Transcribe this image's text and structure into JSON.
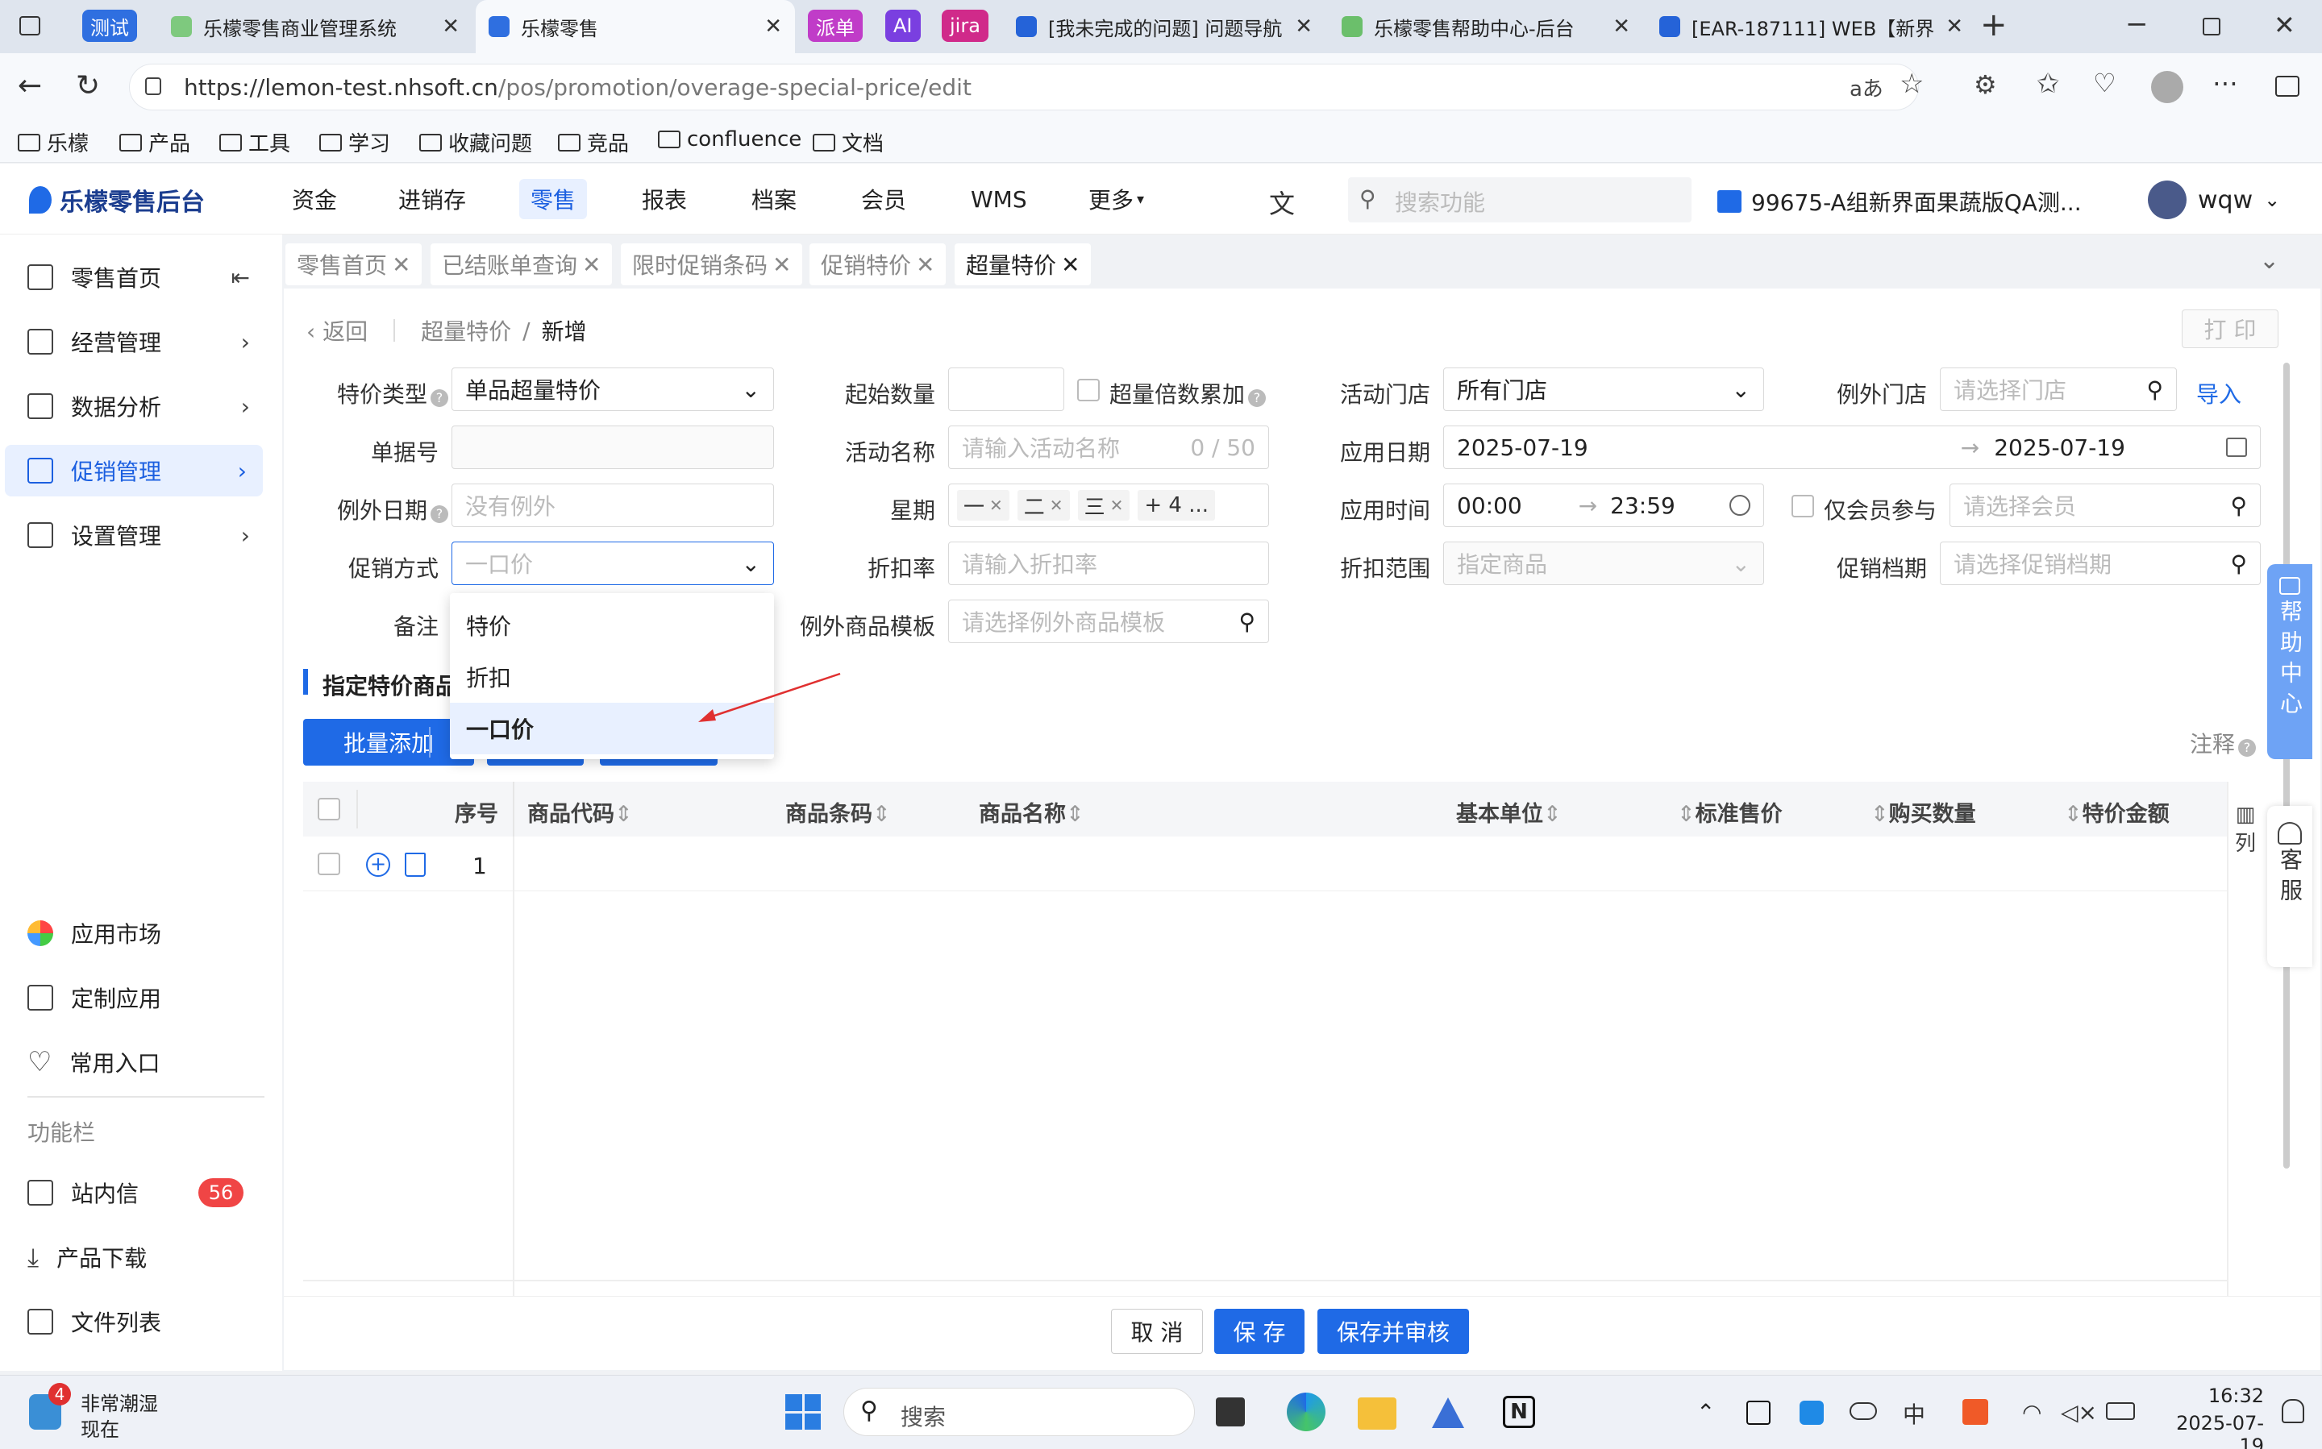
{
  "browser": {
    "tabs": [
      {
        "label": "乐檬零售商业管理系统",
        "group": "测试"
      },
      {
        "label": "乐檬零售"
      },
      {
        "label": "[我未完成的问题] 问题导航"
      },
      {
        "label": "乐檬零售帮助中心-后台"
      },
      {
        "label": "[EAR-187111] WEB【新界"
      }
    ],
    "pills": [
      "派单",
      "AI",
      "jira"
    ],
    "group_label": "测试",
    "url_host": "https://lemon-test.nhsoft.cn",
    "url_path": "/pos/promotion/overage-special-price/edit",
    "bookmarks": [
      "乐檬",
      "产品",
      "工具",
      "学习",
      "收藏问题",
      "竞品",
      "confluence",
      "文档"
    ]
  },
  "header": {
    "logo": "乐檬零售后台",
    "nav": [
      "资金",
      "进销存",
      "零售",
      "报表",
      "档案",
      "会员",
      "WMS",
      "更多"
    ],
    "active_nav": "零售",
    "search_placeholder": "搜索功能",
    "store": "99675-A组新界面果蔬版QA测...",
    "user": "wqw"
  },
  "sidebar": {
    "items": [
      "零售首页",
      "经营管理",
      "数据分析",
      "促销管理",
      "设置管理"
    ],
    "bottom": [
      "应用市场",
      "定制应用",
      "常用入口"
    ],
    "section": "功能栏",
    "tools": [
      "站内信",
      "产品下载",
      "文件列表"
    ],
    "badge": "56"
  },
  "page_tabs": [
    "零售首页",
    "已结账单查询",
    "限时促销条码",
    "促销特价",
    "超量特价"
  ],
  "breadcrumb": {
    "back": "返回",
    "parent": "超量特价",
    "current": "新增"
  },
  "print_label": "打 印",
  "form": {
    "type_label": "特价类型",
    "type_value": "单品超量特价",
    "start_qty_label": "起始数量",
    "multiple_label": "超量倍数累加",
    "store_label": "活动门店",
    "store_value": "所有门店",
    "except_store_label": "例外门店",
    "except_store_ph": "请选择门店",
    "import_label": "导入",
    "billno_label": "单据号",
    "actname_label": "活动名称",
    "actname_ph": "请输入活动名称",
    "actname_count": "0 / 50",
    "date_label": "应用日期",
    "date_start": "2025-07-19",
    "date_end": "2025-07-19",
    "except_date_label": "例外日期",
    "except_date_ph": "没有例外",
    "week_label": "星期",
    "week_tags": [
      "一",
      "二",
      "三"
    ],
    "week_more": "+ 4 ...",
    "time_label": "应用时间",
    "time_start": "00:00",
    "time_end": "23:59",
    "member_only_label": "仅会员参与",
    "member_ph": "请选择会员",
    "method_label": "促销方式",
    "method_ph": "一口价",
    "discount_label": "折扣率",
    "discount_ph": "请输入折扣率",
    "scope_label": "折扣范围",
    "scope_ph": "指定商品",
    "level_label": "促销档期",
    "level_ph": "请选择促销档期",
    "remark_label": "备注",
    "template_label": "例外商品模板",
    "template_ph": "请选择例外商品模板"
  },
  "dropdown": {
    "options": [
      "特价",
      "折扣",
      "一口价"
    ],
    "selected": "一口价"
  },
  "section_title": "指定特价商品",
  "batch_add": "批量添加",
  "note_label": "注释",
  "table": {
    "headers": [
      "序号",
      "商品代码",
      "商品条码",
      "商品名称",
      "基本单位",
      "标准售价",
      "购买数量",
      "特价金额"
    ],
    "rows": [
      {
        "index": "1"
      }
    ],
    "columns_label": "列"
  },
  "footer": {
    "cancel": "取 消",
    "save": "保 存",
    "save_audit": "保存并审核"
  },
  "help": {
    "help_center": "帮助中心",
    "service": "客服"
  },
  "taskbar": {
    "weather_title": "非常潮湿",
    "weather_sub": "现在",
    "weather_badge": "4",
    "search_label": "搜索",
    "time": "16:32",
    "date": "2025-07-19"
  }
}
